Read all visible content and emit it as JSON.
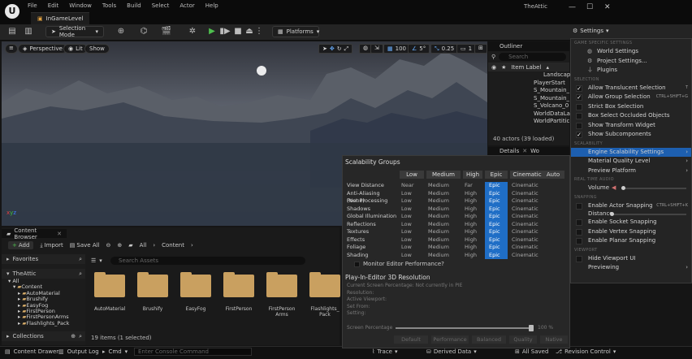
{
  "titlebar": {
    "menu": [
      "File",
      "Edit",
      "Window",
      "Tools",
      "Build",
      "Select",
      "Actor",
      "Help"
    ],
    "tab": "InGameLevel",
    "project": "TheAttic"
  },
  "toolbar": {
    "selection_mode": "Selection Mode",
    "platforms": "Platforms",
    "settings": "Settings"
  },
  "viewport": {
    "perspective": "Perspective",
    "lit": "Lit",
    "show": "Show",
    "grid_snap": "100",
    "rot_snap": "5°",
    "scale_snap": "0.25",
    "cam_speed": "1"
  },
  "outliner": {
    "title": "Outliner",
    "search_placeholder": "Search",
    "col_label": "Item Label",
    "items": [
      "Landscape",
      "PlayerStart",
      "S_Mountain_",
      "S_Mountain_",
      "S_Volcano_0",
      "WorldDataLa",
      "WorldPartitic"
    ],
    "count": "40 actors (39 loaded)",
    "details": "Details",
    "world": "Wo"
  },
  "content_browser": {
    "title": "Content Browser",
    "add": "Add",
    "import": "Import",
    "save_all": "Save All",
    "path": [
      "All",
      "Content"
    ],
    "favorites": "Favorites",
    "project": "TheAttic",
    "search_placeholder": "Search Assets",
    "tree": [
      "All",
      "Content",
      "AutoMaterial",
      "Brushify",
      "EasyFog",
      "FirstPerson",
      "FirstPersonArms",
      "Flashlights_Pack"
    ],
    "collections": "Collections",
    "folders": [
      "AutoMaterial",
      "Brushify",
      "EasyFog",
      "FirstPerson",
      "FirstPerson Arms",
      "Flashlights_ Pack"
    ],
    "status": "19 items (1 selected)"
  },
  "statusbar": {
    "drawer": "Content Drawer",
    "output": "Output Log",
    "cmd": "Cmd",
    "console_placeholder": "Enter Console Command",
    "trace": "Trace",
    "derived": "Derived Data",
    "saved": "All Saved",
    "revision": "Revision Control"
  },
  "scalability": {
    "title": "Scalability Groups",
    "headers": [
      "Low",
      "Medium",
      "High",
      "Epic",
      "Cinematic",
      "Auto"
    ],
    "rows": [
      {
        "label": "View Distance",
        "v": [
          "Near",
          "Medium",
          "Far",
          "Epic",
          "Cinematic"
        ]
      },
      {
        "label": "Anti-Aliasing (None)",
        "v": [
          "Low",
          "Medium",
          "High",
          "Epic",
          "Cinematic"
        ]
      },
      {
        "label": "Post Processing",
        "v": [
          "Low",
          "Medium",
          "High",
          "Epic",
          "Cinematic"
        ]
      },
      {
        "label": "Shadows",
        "v": [
          "Low",
          "Medium",
          "High",
          "Epic",
          "Cinematic"
        ]
      },
      {
        "label": "Global Illumination",
        "v": [
          "Low",
          "Medium",
          "High",
          "Epic",
          "Cinematic"
        ]
      },
      {
        "label": "Reflections",
        "v": [
          "Low",
          "Medium",
          "High",
          "Epic",
          "Cinematic"
        ]
      },
      {
        "label": "Textures",
        "v": [
          "Low",
          "Medium",
          "High",
          "Epic",
          "Cinematic"
        ]
      },
      {
        "label": "Effects",
        "v": [
          "Low",
          "Medium",
          "High",
          "Epic",
          "Cinematic"
        ]
      },
      {
        "label": "Foliage",
        "v": [
          "Low",
          "Medium",
          "High",
          "Epic",
          "Cinematic"
        ]
      },
      {
        "label": "Shading",
        "v": [
          "Low",
          "Medium",
          "High",
          "Epic",
          "Cinematic"
        ]
      }
    ],
    "monitor": "Monitor Editor Performance?",
    "pie_title": "Play-In-Editor 3D Resolution",
    "pie_lines": [
      "Current Screen Percentage: Not currently in PIE",
      "Resolution:",
      "Active Viewport:",
      "Set From:",
      "Setting:"
    ],
    "screen_pct_label": "Screen Percentage",
    "screen_pct_value": "100 %",
    "screen_pct_fraction": 1.0,
    "presets": [
      "Default",
      "Performance",
      "Balanced",
      "Quality",
      "Native"
    ]
  },
  "settings_menu": {
    "sections": {
      "project": "GAME SPECIFIC SETTINGS",
      "selection": "SELECTION",
      "scalability": "SCALABILITY",
      "audio": "REAL TIME AUDIO",
      "snapping": "SNAPPING",
      "viewport": "VIEWPORT"
    },
    "world_settings": "World Settings",
    "project_settings": "Project Settings...",
    "plugins": "Plugins",
    "translucent": "Allow Translucent Selection",
    "translucent_sc": "T",
    "group": "Allow Group Selection",
    "group_sc": "CTRL+SHIFT+G",
    "strict": "Strict Box Selection",
    "occluded": "Box Select Occluded Objects",
    "transform": "Show Transform Widget",
    "subcomponents": "Show Subcomponents",
    "engine_scal": "Engine Scalability Settings",
    "material_q": "Material Quality Level",
    "preview_platform": "Preview Platform",
    "volume": "Volume",
    "volume_level": 0.0,
    "actor_snap": "Enable Actor Snapping",
    "actor_snap_sc": "CTRL+SHIFT+K",
    "distance": "Distance",
    "socket_snap": "Enable Socket Snapping",
    "vertex_snap": "Enable Vertex Snapping",
    "planar_snap": "Enable Planar Snapping",
    "hide_vp_ui": "Hide Viewport UI",
    "previewing": "Previewing"
  },
  "colors": {
    "accent": "#1f6ec6",
    "play": "#4fc04f",
    "folder": "#c9a060"
  }
}
